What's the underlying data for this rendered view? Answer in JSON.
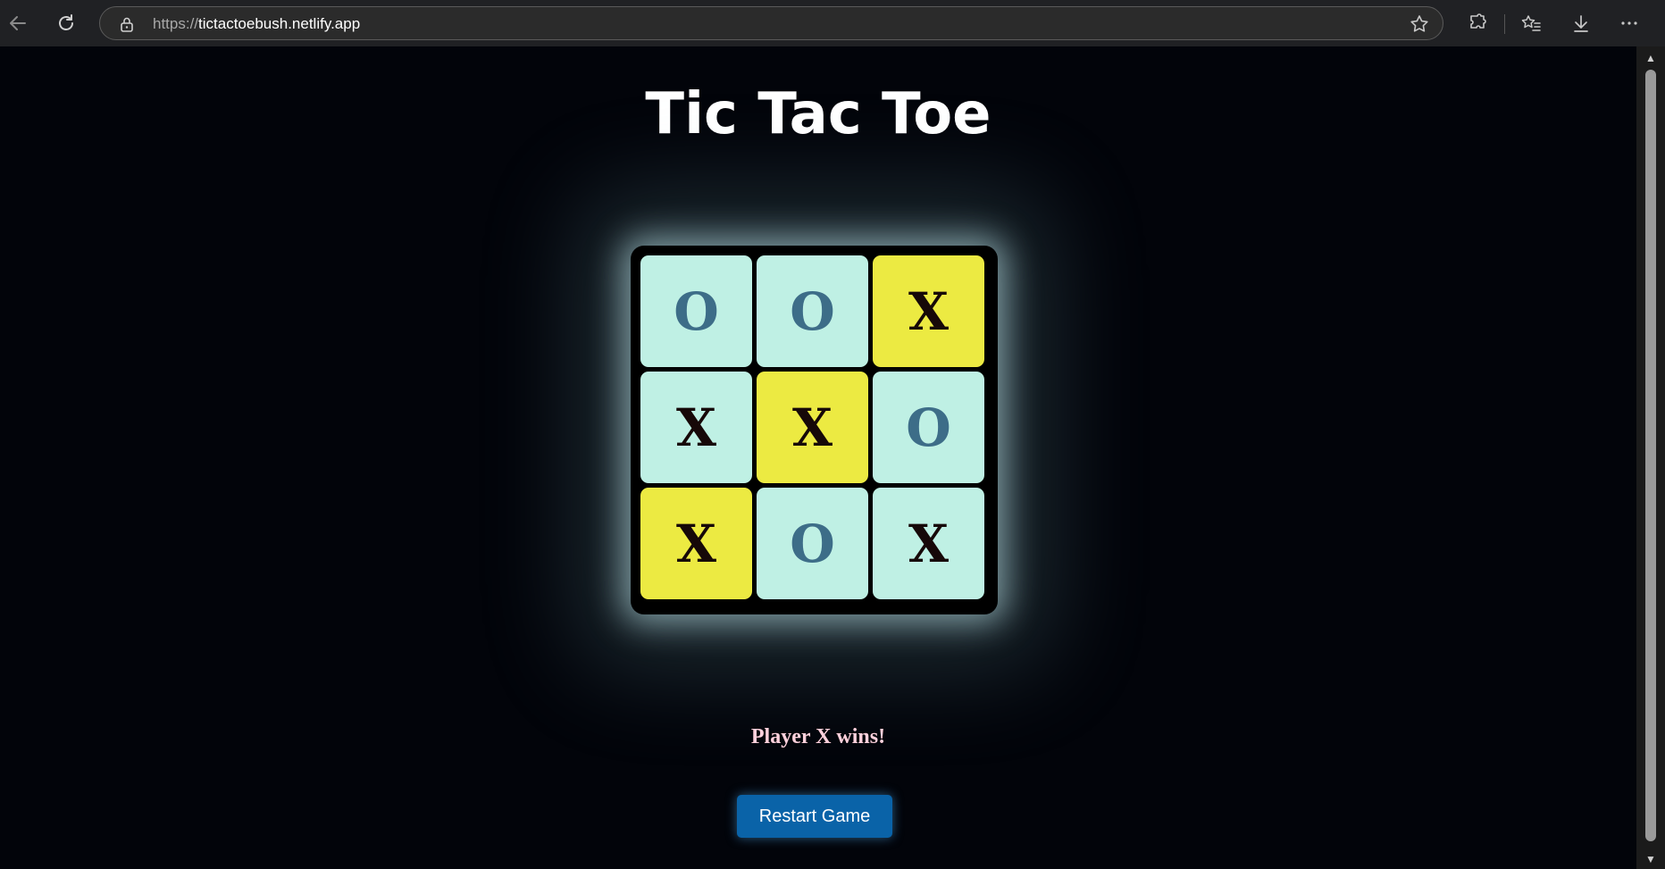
{
  "browser": {
    "url_scheme": "https://",
    "url_host": "tictactoebush.netlify.app"
  },
  "page": {
    "title": "Tic Tac Toe",
    "status": "Player X wins!",
    "restart_label": "Restart Game"
  },
  "board": {
    "cells": [
      "O",
      "O",
      "X",
      "X",
      "X",
      "O",
      "X",
      "O",
      "X"
    ],
    "winning_cells": [
      2,
      4,
      6
    ]
  },
  "colors": {
    "cell_normal": "#bff0e4",
    "cell_winning": "#ecea42",
    "mark_x": "#160808",
    "mark_o": "#3d6d88",
    "status_text": "#ffd1dc",
    "button": "#0a63a8"
  },
  "icons": {
    "back": "back-arrow-icon",
    "refresh": "refresh-icon",
    "lock": "lock-icon",
    "favorite": "star-icon",
    "extensions": "puzzle-icon",
    "favorites_list": "favorites-icon",
    "downloads": "download-icon",
    "more": "more-icon"
  }
}
